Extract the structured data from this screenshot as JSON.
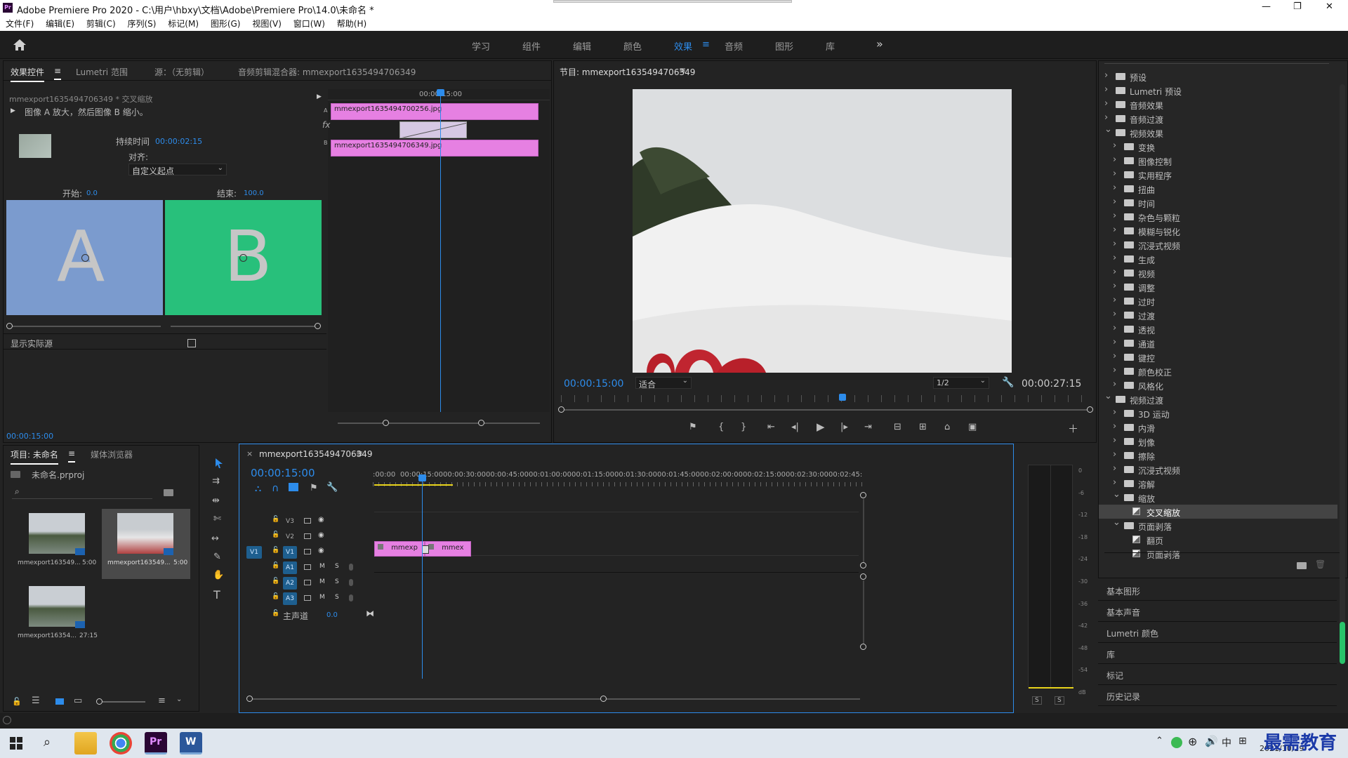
{
  "app": {
    "title": "Adobe Premiere Pro 2020 - C:\\用户\\hbxy\\文档\\Adobe\\Premiere Pro\\14.0\\未命名 *",
    "logo_text": "Pr",
    "window_controls": [
      "—",
      "❐",
      "✕"
    ]
  },
  "menu": [
    "文件(F)",
    "编辑(E)",
    "剪辑(C)",
    "序列(S)",
    "标记(M)",
    "图形(G)",
    "视图(V)",
    "窗口(W)",
    "帮助(H)"
  ],
  "workspaces": [
    "学习",
    "组件",
    "编辑",
    "颜色",
    "效果",
    "音频",
    "图形",
    "库"
  ],
  "workspace_active": "效果",
  "workspace_menu_icon": "≡",
  "more_icon": "»",
  "effect_controls": {
    "tabs": [
      "效果控件",
      "Lumetri 范围",
      "源：（无剪辑）",
      "音频剪辑混合器: mmexport1635494706349"
    ],
    "tab_menu": "≡",
    "breadcrumb": "mmexport1635494706349 * 交叉缩放",
    "description": "图像 A 放大，然后图像 B 缩小。",
    "duration_label": "持续时间",
    "duration_value": "00:00:02:15",
    "align_label": "对齐:",
    "align_value": "自定义起点",
    "start_label": "开始:",
    "start_value": "0.0",
    "end_label": "结束:",
    "end_value": "100.0",
    "thumb_a": "A",
    "thumb_b": "B",
    "show_source": "显示实际源",
    "mini_time": "00:00:15:00",
    "mini_clip_a": "mmexport1635494700256.jpg",
    "mini_clip_b": "mmexport1635494706349.jpg",
    "fx_label": "fx",
    "track_a": "A",
    "track_b": "B",
    "current_time": "00:00:15:00"
  },
  "program": {
    "title": "节目: mmexport1635494706349",
    "timecode": "00:00:15:00",
    "fit": "适合",
    "resolution": "1/2",
    "duration": "00:00:27:15",
    "buttons": [
      "⚑",
      "{",
      "}",
      "⇤",
      "◂|",
      "▶",
      "|▸",
      "⇥",
      "⊟",
      "⊞",
      "⌂",
      "▣",
      "＋"
    ]
  },
  "effects_panel": {
    "items": [
      {
        "label": "预设",
        "depth": 0,
        "type": "folder",
        "open": false
      },
      {
        "label": "Lumetri 预设",
        "depth": 0,
        "type": "folder",
        "open": false
      },
      {
        "label": "音频效果",
        "depth": 0,
        "type": "folder",
        "open": false
      },
      {
        "label": "音频过渡",
        "depth": 0,
        "type": "folder",
        "open": false
      },
      {
        "label": "视频效果",
        "depth": 0,
        "type": "folder",
        "open": true
      },
      {
        "label": "变换",
        "depth": 1,
        "type": "folder",
        "open": false
      },
      {
        "label": "图像控制",
        "depth": 1,
        "type": "folder",
        "open": false
      },
      {
        "label": "实用程序",
        "depth": 1,
        "type": "folder",
        "open": false
      },
      {
        "label": "扭曲",
        "depth": 1,
        "type": "folder",
        "open": false
      },
      {
        "label": "时间",
        "depth": 1,
        "type": "folder",
        "open": false
      },
      {
        "label": "杂色与颗粒",
        "depth": 1,
        "type": "folder",
        "open": false
      },
      {
        "label": "模糊与锐化",
        "depth": 1,
        "type": "folder",
        "open": false
      },
      {
        "label": "沉浸式视频",
        "depth": 1,
        "type": "folder",
        "open": false
      },
      {
        "label": "生成",
        "depth": 1,
        "type": "folder",
        "open": false
      },
      {
        "label": "视频",
        "depth": 1,
        "type": "folder",
        "open": false
      },
      {
        "label": "调整",
        "depth": 1,
        "type": "folder",
        "open": false
      },
      {
        "label": "过时",
        "depth": 1,
        "type": "folder",
        "open": false
      },
      {
        "label": "过渡",
        "depth": 1,
        "type": "folder",
        "open": false
      },
      {
        "label": "透视",
        "depth": 1,
        "type": "folder",
        "open": false
      },
      {
        "label": "通道",
        "depth": 1,
        "type": "folder",
        "open": false
      },
      {
        "label": "键控",
        "depth": 1,
        "type": "folder",
        "open": false
      },
      {
        "label": "颜色校正",
        "depth": 1,
        "type": "folder",
        "open": false
      },
      {
        "label": "风格化",
        "depth": 1,
        "type": "folder",
        "open": false
      },
      {
        "label": "视频过渡",
        "depth": 0,
        "type": "folder",
        "open": true
      },
      {
        "label": "3D 运动",
        "depth": 1,
        "type": "folder",
        "open": false
      },
      {
        "label": "内滑",
        "depth": 1,
        "type": "folder",
        "open": false
      },
      {
        "label": "划像",
        "depth": 1,
        "type": "folder",
        "open": false
      },
      {
        "label": "擦除",
        "depth": 1,
        "type": "folder",
        "open": false
      },
      {
        "label": "沉浸式视频",
        "depth": 1,
        "type": "folder",
        "open": false
      },
      {
        "label": "溶解",
        "depth": 1,
        "type": "folder",
        "open": false
      },
      {
        "label": "缩放",
        "depth": 1,
        "type": "folder",
        "open": true
      },
      {
        "label": "交叉缩放",
        "depth": 2,
        "type": "effect",
        "selected": true
      },
      {
        "label": "页面剥落",
        "depth": 1,
        "type": "folder",
        "open": true
      },
      {
        "label": "翻页",
        "depth": 2,
        "type": "effect"
      },
      {
        "label": "页面剥落",
        "depth": 2,
        "type": "effect"
      }
    ],
    "sections": [
      "基本图形",
      "基本声音",
      "Lumetri 颜色",
      "库",
      "标记",
      "历史记录"
    ]
  },
  "project": {
    "tabs": [
      "项目: 未命名",
      "媒体浏览器"
    ],
    "tab_menu": "≡",
    "file": "未命名.prproj",
    "items": [
      {
        "name": "mmexport163549...",
        "dur": "5:00"
      },
      {
        "name": "mmexport163549...",
        "dur": "5:00"
      },
      {
        "name": "mmexport16354...",
        "dur": "27:15"
      }
    ]
  },
  "timeline": {
    "close_icon": "×",
    "title": "mmexport1635494706349",
    "menu_icon": "≡",
    "timecode": "00:00:15:00",
    "ruler": [
      ":00:00",
      "00:00:15:00",
      "00:00:30:00",
      "00:00:45:00",
      "00:01:00:00",
      "00:01:15:00",
      "00:01:30:00",
      "00:01:45:00",
      "00:02:00:00",
      "00:02:15:00",
      "00:02:30:00",
      "00:02:45:"
    ],
    "video_tracks": [
      "V3",
      "V2",
      "V1"
    ],
    "audio_tracks": [
      "A1",
      "A2",
      "A3"
    ],
    "source_patch": "V1",
    "master_label": "主声道",
    "master_value": "0.0",
    "m": "M",
    "s": "S",
    "clip1": "mmexp",
    "clip2": "mmex"
  },
  "meter": {
    "labels": [
      "0",
      "-6",
      "-12",
      "-18",
      "-24",
      "-30",
      "-36",
      "-42",
      "-48",
      "-54",
      "dB"
    ],
    "solo": [
      "S",
      "S"
    ]
  },
  "taskbar": {
    "lang": "中",
    "date": "2021/10/29",
    "watermark": "最需教育"
  }
}
